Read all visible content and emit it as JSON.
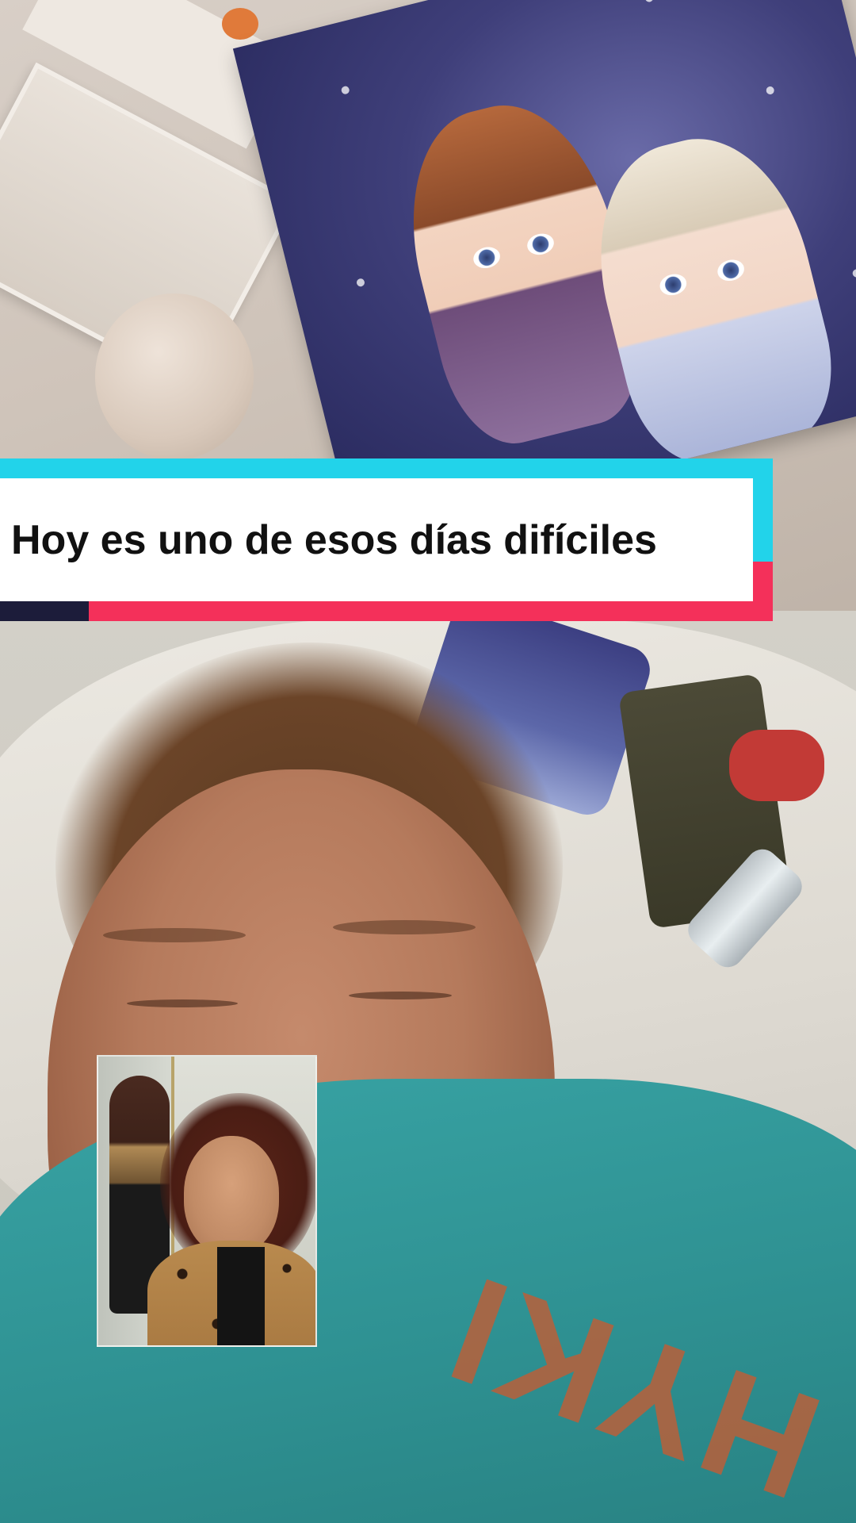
{
  "caption": {
    "text": "Hoy es uno de esos días difíciles"
  },
  "shirt": {
    "print_text": "HYKI"
  },
  "colors": {
    "caption_cyan": "#22d3ea",
    "caption_pink": "#f4305a",
    "caption_background": "#ffffff",
    "caption_text": "#111111",
    "shirt_teal": "#38a3a4"
  }
}
